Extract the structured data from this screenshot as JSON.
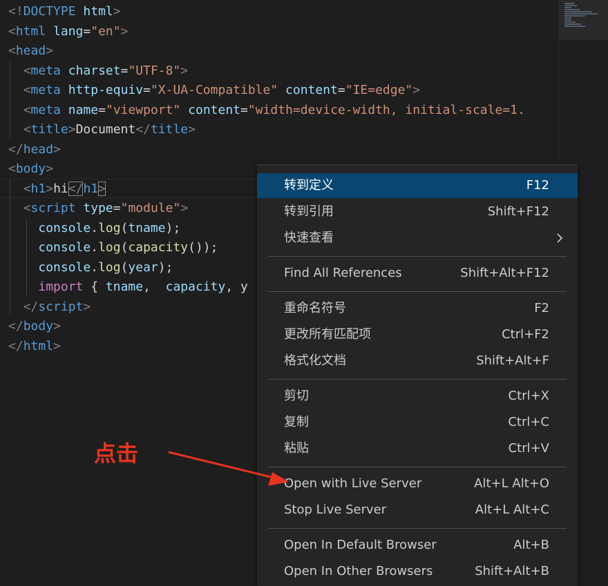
{
  "editor": {
    "lines": [
      [
        {
          "t": "<!",
          "c": "br"
        },
        {
          "t": "DOCTYPE",
          "c": "tag"
        },
        {
          "t": " ",
          "c": "txt"
        },
        {
          "t": "html",
          "c": "attr"
        },
        {
          "t": ">",
          "c": "br"
        }
      ],
      [
        {
          "t": "<",
          "c": "br"
        },
        {
          "t": "html",
          "c": "tag"
        },
        {
          "t": " ",
          "c": "txt"
        },
        {
          "t": "lang",
          "c": "attr"
        },
        {
          "t": "=",
          "c": "txt"
        },
        {
          "t": "\"en\"",
          "c": "str"
        },
        {
          "t": ">",
          "c": "br"
        }
      ],
      [
        {
          "t": "<",
          "c": "br"
        },
        {
          "t": "head",
          "c": "tag"
        },
        {
          "t": ">",
          "c": "br"
        }
      ],
      [
        {
          "t": "  ",
          "c": "txt"
        },
        {
          "t": "<",
          "c": "br"
        },
        {
          "t": "meta",
          "c": "tag"
        },
        {
          "t": " ",
          "c": "txt"
        },
        {
          "t": "charset",
          "c": "attr"
        },
        {
          "t": "=",
          "c": "txt"
        },
        {
          "t": "\"UTF-8\"",
          "c": "str"
        },
        {
          "t": ">",
          "c": "br"
        }
      ],
      [
        {
          "t": "  ",
          "c": "txt"
        },
        {
          "t": "<",
          "c": "br"
        },
        {
          "t": "meta",
          "c": "tag"
        },
        {
          "t": " ",
          "c": "txt"
        },
        {
          "t": "http-equiv",
          "c": "attr"
        },
        {
          "t": "=",
          "c": "txt"
        },
        {
          "t": "\"X-UA-Compatible\"",
          "c": "str"
        },
        {
          "t": " ",
          "c": "txt"
        },
        {
          "t": "content",
          "c": "attr"
        },
        {
          "t": "=",
          "c": "txt"
        },
        {
          "t": "\"IE=edge\"",
          "c": "str"
        },
        {
          "t": ">",
          "c": "br"
        }
      ],
      [
        {
          "t": "  ",
          "c": "txt"
        },
        {
          "t": "<",
          "c": "br"
        },
        {
          "t": "meta",
          "c": "tag"
        },
        {
          "t": " ",
          "c": "txt"
        },
        {
          "t": "name",
          "c": "attr"
        },
        {
          "t": "=",
          "c": "txt"
        },
        {
          "t": "\"viewport\"",
          "c": "str"
        },
        {
          "t": " ",
          "c": "txt"
        },
        {
          "t": "content",
          "c": "attr"
        },
        {
          "t": "=",
          "c": "txt"
        },
        {
          "t": "\"width=device-width, initial-scale=1.",
          "c": "str"
        }
      ],
      [
        {
          "t": "  ",
          "c": "txt"
        },
        {
          "t": "<",
          "c": "br"
        },
        {
          "t": "title",
          "c": "tag"
        },
        {
          "t": ">",
          "c": "br"
        },
        {
          "t": "Document",
          "c": "txt"
        },
        {
          "t": "</",
          "c": "br"
        },
        {
          "t": "title",
          "c": "tag"
        },
        {
          "t": ">",
          "c": "br"
        }
      ],
      [
        {
          "t": "</",
          "c": "br"
        },
        {
          "t": "head",
          "c": "tag"
        },
        {
          "t": ">",
          "c": "br"
        }
      ],
      [
        {
          "t": "<",
          "c": "br"
        },
        {
          "t": "body",
          "c": "tag"
        },
        {
          "t": ">",
          "c": "br"
        }
      ],
      [
        {
          "t": "  ",
          "c": "txt"
        },
        {
          "t": "<",
          "c": "br"
        },
        {
          "t": "h1",
          "c": "tag"
        },
        {
          "t": ">",
          "c": "br"
        },
        {
          "t": "hi",
          "c": "txt"
        },
        {
          "t": "</",
          "c": "br",
          "m": 1
        },
        {
          "t": "h1",
          "c": "tag"
        },
        {
          "t": ">",
          "c": "br",
          "m": 1
        }
      ],
      [
        {
          "t": "  ",
          "c": "txt"
        },
        {
          "t": "<",
          "c": "br"
        },
        {
          "t": "script",
          "c": "tag"
        },
        {
          "t": " ",
          "c": "txt"
        },
        {
          "t": "type",
          "c": "attr"
        },
        {
          "t": "=",
          "c": "txt"
        },
        {
          "t": "\"module\"",
          "c": "str"
        },
        {
          "t": ">",
          "c": "br"
        }
      ],
      [
        {
          "t": "    ",
          "c": "txt"
        },
        {
          "t": "console",
          "c": "attr"
        },
        {
          "t": ".",
          "c": "txt"
        },
        {
          "t": "log",
          "c": "fn"
        },
        {
          "t": "(",
          "c": "txt"
        },
        {
          "t": "tname",
          "c": "attr"
        },
        {
          "t": ");",
          "c": "txt"
        }
      ],
      [
        {
          "t": "    ",
          "c": "txt"
        },
        {
          "t": "console",
          "c": "attr"
        },
        {
          "t": ".",
          "c": "txt"
        },
        {
          "t": "log",
          "c": "fn"
        },
        {
          "t": "(",
          "c": "txt"
        },
        {
          "t": "capacity",
          "c": "fn"
        },
        {
          "t": "());",
          "c": "txt"
        }
      ],
      [
        {
          "t": "    ",
          "c": "txt"
        },
        {
          "t": "console",
          "c": "attr"
        },
        {
          "t": ".",
          "c": "txt"
        },
        {
          "t": "log",
          "c": "fn"
        },
        {
          "t": "(",
          "c": "txt"
        },
        {
          "t": "year",
          "c": "attr"
        },
        {
          "t": ");",
          "c": "txt"
        }
      ],
      [
        {
          "t": "    ",
          "c": "txt"
        },
        {
          "t": "import",
          "c": "kw"
        },
        {
          "t": " { ",
          "c": "txt"
        },
        {
          "t": "tname",
          "c": "attr"
        },
        {
          "t": ",  ",
          "c": "txt"
        },
        {
          "t": "capacity",
          "c": "attr"
        },
        {
          "t": ", y",
          "c": "txt"
        }
      ],
      [
        {
          "t": "  ",
          "c": "txt"
        },
        {
          "t": "</",
          "c": "br"
        },
        {
          "t": "script",
          "c": "tag"
        },
        {
          "t": ">",
          "c": "br"
        }
      ],
      [
        {
          "t": "</",
          "c": "br"
        },
        {
          "t": "body",
          "c": "tag"
        },
        {
          "t": ">",
          "c": "br"
        }
      ],
      [
        {
          "t": "</",
          "c": "br"
        },
        {
          "t": "html",
          "c": "tag"
        },
        {
          "t": ">",
          "c": "br"
        }
      ]
    ]
  },
  "colors": {
    "br": "#808080",
    "tag": "#569cd6",
    "attr": "#9cdcfe",
    "str": "#ce9178",
    "txt": "#d4d4d4",
    "fn": "#dcdcaa",
    "kw": "#c586c0",
    "menu_active": "#094771",
    "annotation": "#e8331f"
  },
  "menu": {
    "items": [
      {
        "label": "转到定义",
        "key": "F12",
        "active": true
      },
      {
        "label": "转到引用",
        "key": "Shift+F12"
      },
      {
        "label": "快速查看",
        "key": "",
        "submenu": true
      },
      {
        "sep": true
      },
      {
        "label": "Find All References",
        "key": "Shift+Alt+F12"
      },
      {
        "sep": true
      },
      {
        "label": "重命名符号",
        "key": "F2"
      },
      {
        "label": "更改所有匹配项",
        "key": "Ctrl+F2"
      },
      {
        "label": "格式化文档",
        "key": "Shift+Alt+F"
      },
      {
        "sep": true
      },
      {
        "label": "剪切",
        "key": "Ctrl+X"
      },
      {
        "label": "复制",
        "key": "Ctrl+C"
      },
      {
        "label": "粘贴",
        "key": "Ctrl+V"
      },
      {
        "sep": true
      },
      {
        "label": "Open with Live Server",
        "key": "Alt+L Alt+O"
      },
      {
        "label": "Stop Live Server",
        "key": "Alt+L Alt+C"
      },
      {
        "sep": true
      },
      {
        "label": "Open In Default Browser",
        "key": "Alt+B"
      },
      {
        "label": "Open In Other Browsers",
        "key": "Shift+Alt+B"
      }
    ]
  },
  "annotation": {
    "text": "点击"
  },
  "icons": {
    "submenu": "chevron-right-icon",
    "arrow": "annotation-arrow-icon"
  }
}
